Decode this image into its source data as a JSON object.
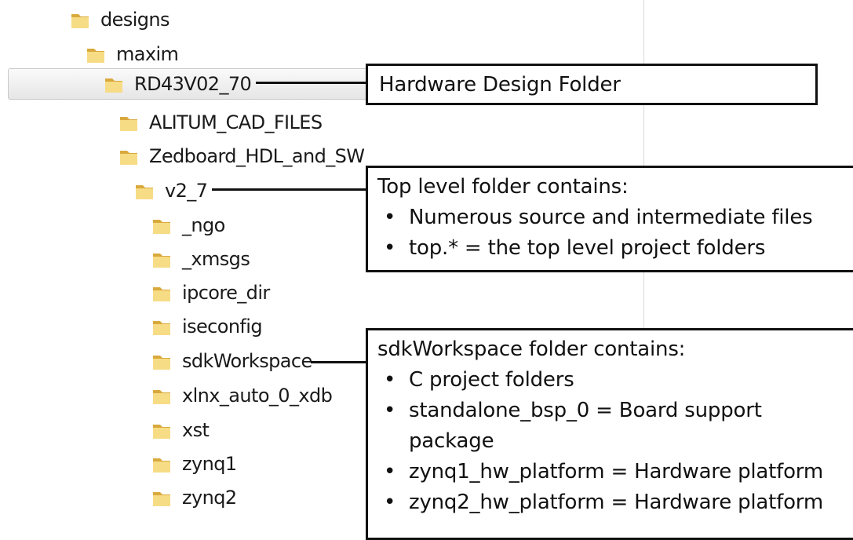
{
  "tree": {
    "items": [
      {
        "label": "designs",
        "depth": 0
      },
      {
        "label": "maxim",
        "depth": 1
      },
      {
        "label": "RD43V02_70",
        "depth": 2,
        "selected": true
      },
      {
        "label": "ALITUM_CAD_FILES",
        "depth": 3
      },
      {
        "label": "Zedboard_HDL_and_SW",
        "depth": 3
      },
      {
        "label": "v2_7",
        "depth": 4
      },
      {
        "label": "_ngo",
        "depth": 5
      },
      {
        "label": "_xmsgs",
        "depth": 5
      },
      {
        "label": "ipcore_dir",
        "depth": 5
      },
      {
        "label": "iseconfig",
        "depth": 5
      },
      {
        "label": "sdkWorkspace",
        "depth": 5
      },
      {
        "label": "xlnx_auto_0_xdb",
        "depth": 5
      },
      {
        "label": "xst",
        "depth": 5
      },
      {
        "label": "zynq1",
        "depth": 5
      },
      {
        "label": "zynq2",
        "depth": 5
      }
    ]
  },
  "callouts": {
    "hardware": {
      "text": "Hardware Design Folder"
    },
    "top": {
      "heading": "Top level folder contains:",
      "bullets": [
        "Numerous source and intermediate files",
        "top.* = the top level project folders"
      ]
    },
    "sdk": {
      "heading": "sdkWorkspace folder contains:",
      "bullets": [
        "C project folders",
        "standalone_bsp_0 = Board support package",
        "zynq1_hw_platform = Hardware platform",
        "zynq2_hw_platform = Hardware platform"
      ]
    }
  },
  "colors": {
    "folder_light": "#f7dc86",
    "folder_dark": "#d9a93c",
    "selection": "#e8e8e8"
  }
}
